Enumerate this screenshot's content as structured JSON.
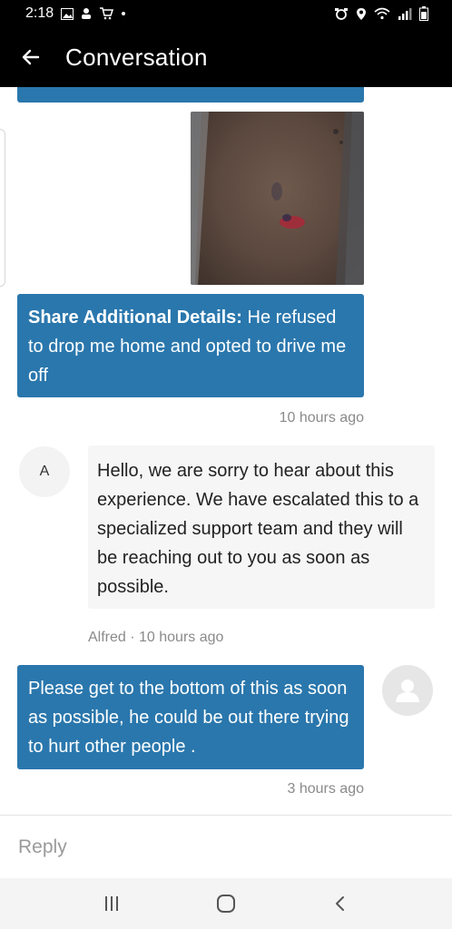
{
  "status_bar": {
    "time": "2:18",
    "left_icons": [
      "gallery-icon",
      "notification-icon",
      "cart-icon",
      "dot-icon"
    ],
    "right_icons": [
      "alarm-icon",
      "location-icon",
      "wifi-icon",
      "signal-icon",
      "battery-icon"
    ]
  },
  "header": {
    "title": "Conversation",
    "back_icon": "arrow-left-icon"
  },
  "messages": [
    {
      "sender": "user",
      "type": "image",
      "image_description_icon": "attached-photo"
    },
    {
      "sender": "user",
      "label": "Share Additional Details:",
      "text": " He refused to drop me home and opted to drive me off",
      "time": "10 hours ago"
    },
    {
      "sender": "agent",
      "avatar_initial": "A",
      "text": "Hello, we are sorry to hear about this experience. We have escalated this to a specialized support team and they will be reaching out to you as soon as possible.",
      "meta": "Alfred · 10 hours ago"
    },
    {
      "sender": "user",
      "text": "Please get to the bottom of this as soon as possible, he could be out there trying to hurt other people .",
      "time": "3 hours ago"
    }
  ],
  "reply": {
    "placeholder": "Reply"
  },
  "nav_bar": {
    "icons": [
      "recent-apps-icon",
      "home-icon",
      "back-icon"
    ]
  },
  "colors": {
    "accent_blue": "#2a77ad",
    "header_bg": "#000000",
    "agent_bubble": "#f6f6f6"
  }
}
